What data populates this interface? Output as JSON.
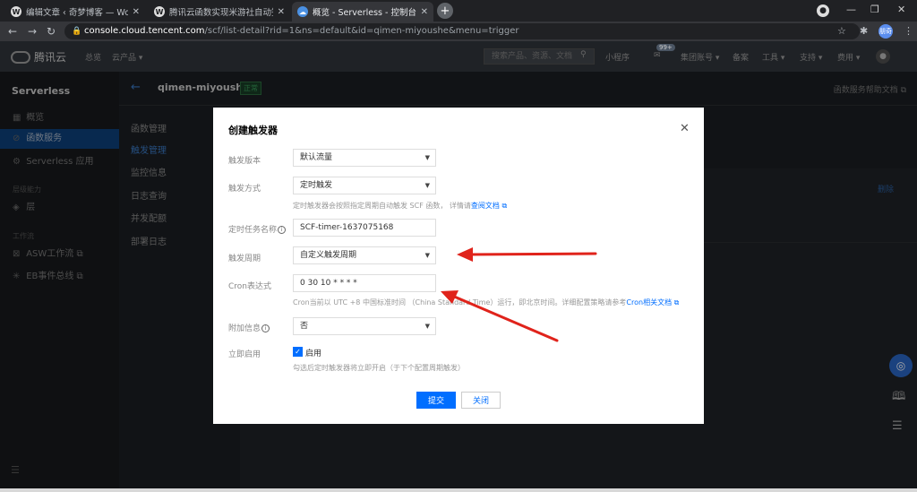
{
  "browser": {
    "tabs": [
      {
        "label": "编辑文章 ‹ 奇梦博客 — WordPre",
        "active": false
      },
      {
        "label": "腾讯云函数实现米游社自动签到",
        "active": false
      },
      {
        "label": "概览 - Serverless - 控制台",
        "active": true
      }
    ],
    "url_host": "console.cloud.tencent.com",
    "url_path": "/scf/list-detail?rid=1&ns=default&id=qimen-miyoushe&menu=trigger",
    "profile_label": "朋奇"
  },
  "console_header": {
    "brand": "腾讯云",
    "nav": [
      "总览",
      "云产品 ▾"
    ],
    "search_placeholder": "搜索产品、资源、文档",
    "right_items": [
      "小程序",
      "集团账号 ▾",
      "备案",
      "工具 ▾",
      "支持 ▾",
      "费用 ▾"
    ],
    "notify_count": "99+"
  },
  "sidebar": {
    "title": "Serverless",
    "items": [
      {
        "label": "概览",
        "icon": "grid-icon"
      },
      {
        "label": "函数服务",
        "icon": "function-icon"
      },
      {
        "label": "Serverless 应用",
        "icon": "app-icon"
      }
    ],
    "group_lib": "层级能力",
    "layer_item": "层",
    "group_flow": "工作流",
    "asw_item": "ASW工作流 ⧉",
    "eb_item": "EB事件总线 ⧉"
  },
  "page": {
    "function_name": "qimen-miyoushe",
    "status": "正常",
    "help_doc": "函数服务帮助文档 ⧉",
    "subnav": [
      "函数管理",
      "触发管理",
      "监控信息",
      "日志查询",
      "并发配额",
      "部署日志"
    ],
    "delete_link": "删除"
  },
  "modal": {
    "title": "创建触发器",
    "version_label": "触发版本",
    "version_value": "默认流量",
    "method_label": "触发方式",
    "method_value": "定时触发",
    "method_hint": "定时触发器会按照指定周期自动触发 SCF 函数， 详情请",
    "method_hint_link": "查阅文档",
    "taskname_label": "定时任务名称",
    "taskname_value": "SCF-timer-1637075168",
    "period_label": "触发周期",
    "period_value": "自定义触发周期",
    "cron_label": "Cron表达式",
    "cron_value": "0 30 10 * * * *",
    "cron_hint": "Cron当前以 UTC +8 中国标准时间 （China Standard Time）运行，即北京时间。详细配置策略请参考",
    "cron_hint_link": "Cron相关文档",
    "extra_label": "附加信息",
    "extra_value": "否",
    "enable_label": "立即启用",
    "enable_checkbox_label": "启用",
    "enable_hint": "勾选后定时触发器将立即开启（于下个配置周期触发）",
    "submit_label": "提交",
    "cancel_label": "关闭"
  },
  "colors": {
    "accent": "#006eff",
    "arrow": "#e0231b",
    "sidebar_active": "#0d3f7a"
  }
}
